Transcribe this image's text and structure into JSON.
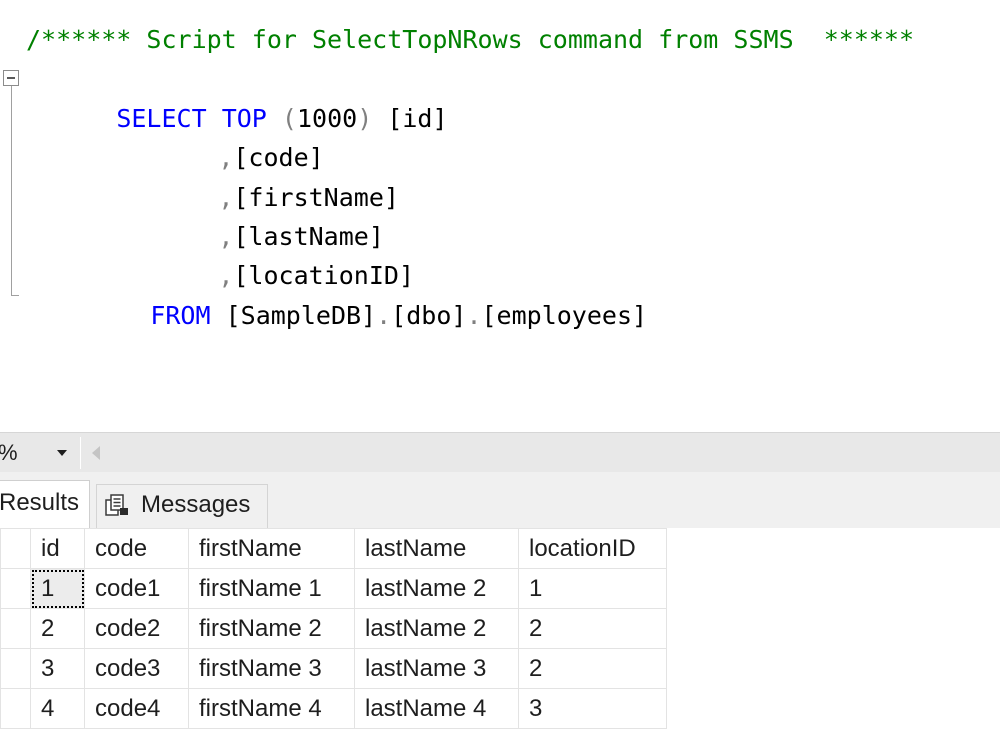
{
  "editor": {
    "comment_line": "/****** Script for SelectTopNRows command from SSMS  ******",
    "select_keyword": "SELECT",
    "top_keyword": "TOP",
    "top_open_paren": "(",
    "top_count": "1000",
    "top_close_paren": ")",
    "first_column": "[id]",
    "column_comma": ",",
    "columns": [
      "[code]",
      "[firstName]",
      "[lastName]",
      "[locationID]"
    ],
    "from_keyword": "FROM",
    "db_part": "[SampleDB]",
    "dot": ".",
    "schema_part": "[dbo]",
    "table_part": "[employees]"
  },
  "zoom": {
    "value": "%"
  },
  "tabs": {
    "results_label": "Results",
    "messages_label": "Messages",
    "messages_icon": "messages-icon"
  },
  "grid": {
    "headers": [
      "id",
      "code",
      "firstName",
      "lastName",
      "locationID"
    ],
    "rows": [
      [
        "1",
        "code1",
        "firstName 1",
        "lastName 2",
        "1"
      ],
      [
        "2",
        "code2",
        "firstName 2",
        "lastName 2",
        "2"
      ],
      [
        "3",
        "code3",
        "firstName 3",
        "lastName 3",
        "2"
      ],
      [
        "4",
        "code4",
        "firstName 4",
        "lastName 4",
        "3"
      ]
    ],
    "selected_cell": {
      "row": 0,
      "col": 0
    }
  },
  "colors": {
    "keyword": "#0000ff",
    "comment": "#008000",
    "punctuation": "#808080"
  }
}
